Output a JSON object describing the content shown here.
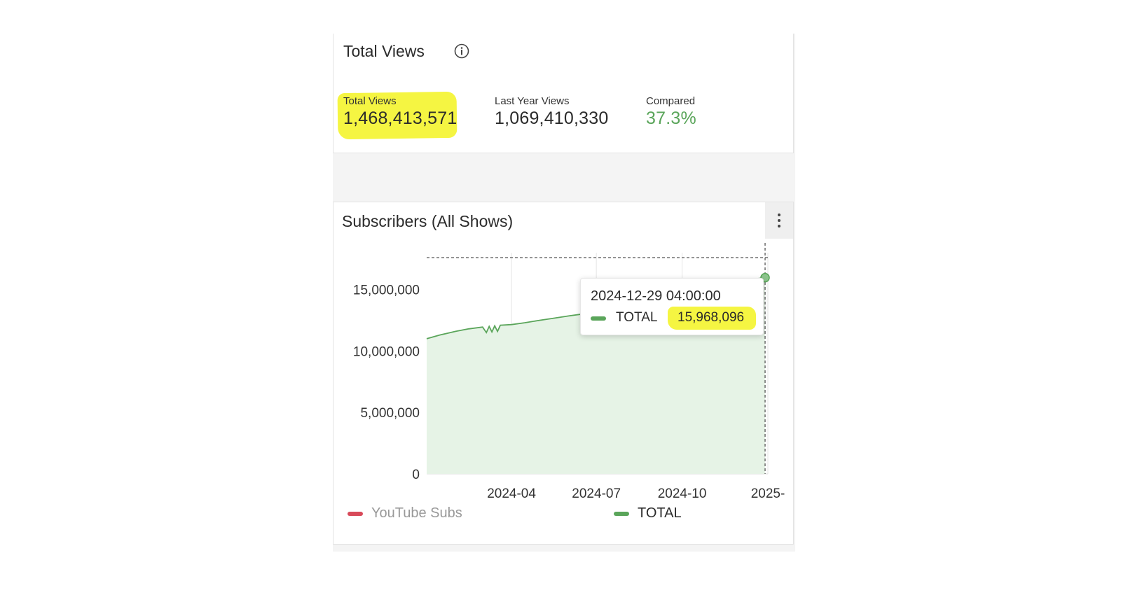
{
  "views_card": {
    "title": "Total Views",
    "info_icon": "info-circle-icon",
    "stats": [
      {
        "label": "Total Views",
        "value": "1,468,413,571",
        "highlighted": true
      },
      {
        "label": "Last Year Views",
        "value": "1,069,410,330"
      },
      {
        "label": "Compared",
        "value": "37.3%",
        "color": "#5aa55a"
      }
    ]
  },
  "subs_card": {
    "title": "Subscribers (All Shows)",
    "menu_icon": "vertical-dots-icon",
    "tooltip": {
      "date": "2024-12-29 04:00:00",
      "series": "TOTAL",
      "value": "15,968,096"
    },
    "legend": [
      {
        "name": "YouTube Subs",
        "color": "#d84a5a",
        "state": "hidden"
      },
      {
        "name": "TOTAL",
        "color": "#5aa55a",
        "state": "visible"
      }
    ]
  },
  "chart_data": {
    "type": "area",
    "x_tick_labels": [
      "2024-04",
      "2024-07",
      "2024-10",
      "2025-"
    ],
    "y_tick_labels": [
      "15,000,000",
      "10,000,000",
      "5,000,000",
      "0"
    ],
    "ylim": [
      0,
      18000000
    ],
    "grid": true,
    "series": [
      {
        "name": "TOTAL",
        "color": "#5aa55a",
        "points": [
          [
            "2024-01-01",
            11000000
          ],
          [
            "2024-01-15",
            11300000
          ],
          [
            "2024-02-01",
            11600000
          ],
          [
            "2024-02-15",
            11800000
          ],
          [
            "2024-03-01",
            11950000
          ],
          [
            "2024-03-05",
            11500000
          ],
          [
            "2024-03-08",
            12000000
          ],
          [
            "2024-03-11",
            11550000
          ],
          [
            "2024-03-14",
            12050000
          ],
          [
            "2024-03-17",
            11600000
          ],
          [
            "2024-03-20",
            12100000
          ],
          [
            "2024-04-01",
            12150000
          ],
          [
            "2024-04-15",
            12300000
          ],
          [
            "2024-05-01",
            12500000
          ],
          [
            "2024-05-15",
            12650000
          ],
          [
            "2024-06-01",
            12850000
          ],
          [
            "2024-06-15",
            13000000
          ],
          [
            "2024-07-01",
            13200000
          ],
          [
            "2024-07-15",
            13400000
          ],
          [
            "2024-08-01",
            13650000
          ],
          [
            "2024-08-15",
            13850000
          ],
          [
            "2024-09-01",
            14100000
          ],
          [
            "2024-09-15",
            14350000
          ],
          [
            "2024-10-01",
            14600000
          ],
          [
            "2024-10-15",
            14850000
          ],
          [
            "2024-11-01",
            15150000
          ],
          [
            "2024-11-15",
            15450000
          ],
          [
            "2024-12-01",
            15700000
          ],
          [
            "2024-12-29",
            15968096
          ]
        ]
      }
    ],
    "reference_line": 17600000,
    "crosshair_x": "2024-12-29"
  }
}
